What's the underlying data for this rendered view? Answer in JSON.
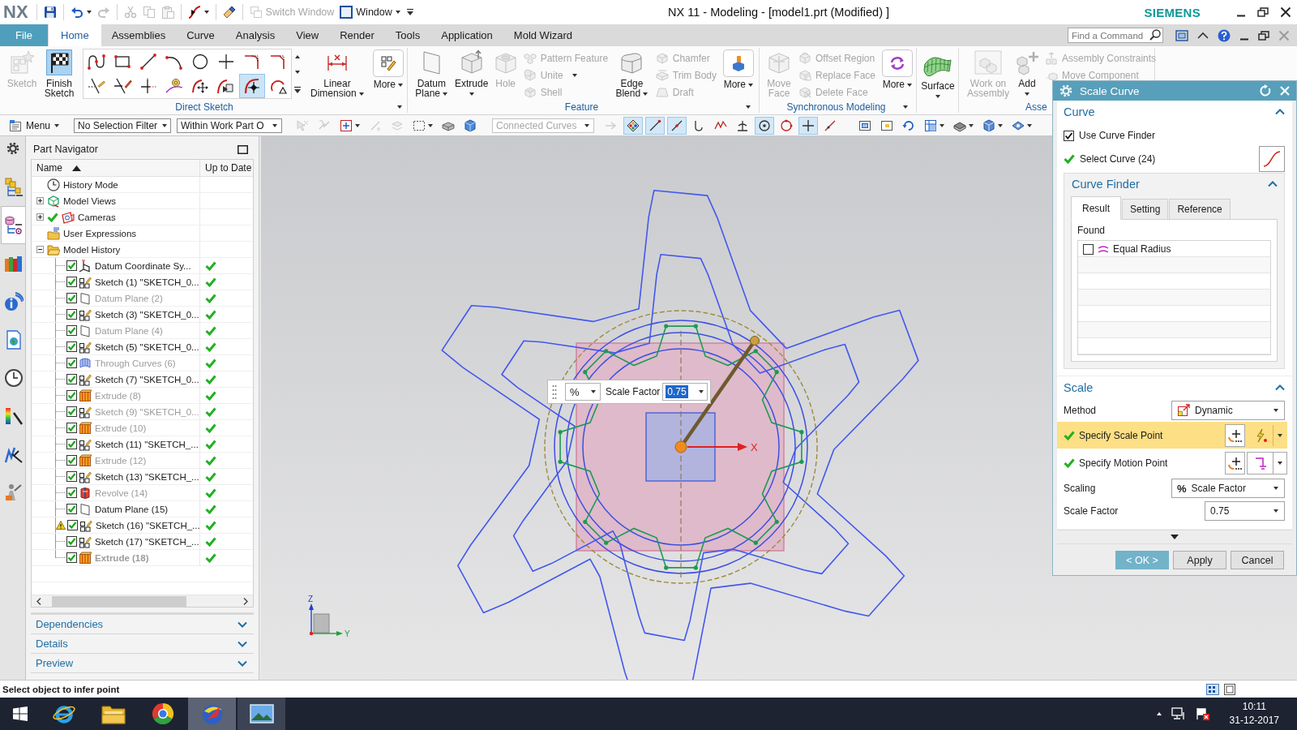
{
  "title_bar": {
    "logo": "NX",
    "quick_access": [
      [
        {
          "kind": "save",
          "disabled": false
        }
      ],
      [
        {
          "kind": "undo",
          "disabled": false,
          "dropdown": true
        },
        {
          "kind": "redo",
          "disabled": true
        }
      ],
      [
        {
          "kind": "cut",
          "disabled": true
        },
        {
          "kind": "copy",
          "disabled": true
        },
        {
          "kind": "paste",
          "disabled": true
        }
      ],
      [
        {
          "kind": "curve_tool",
          "disabled": false,
          "dropdown": true
        }
      ],
      [
        {
          "kind": "eraser",
          "disabled": false
        }
      ],
      [
        {
          "kind": "switch_window",
          "label": "Switch Window",
          "disabled": true
        },
        {
          "kind": "window",
          "label": "Window",
          "disabled": false,
          "dropdown": true
        }
      ]
    ],
    "title": "NX 11 - Modeling - [model1.prt (Modified) ]",
    "brand": "SIEMENS"
  },
  "menu_tabs": [
    {
      "label": "File",
      "kind": "file",
      "selected": false
    },
    {
      "label": "Home",
      "kind": "tab",
      "selected": true
    },
    {
      "label": "Assemblies",
      "kind": "tab",
      "selected": false
    },
    {
      "label": "Curve",
      "kind": "tab",
      "selected": false
    },
    {
      "label": "Analysis",
      "kind": "tab",
      "selected": false
    },
    {
      "label": "View",
      "kind": "tab",
      "selected": false
    },
    {
      "label": "Render",
      "kind": "tab",
      "selected": false
    },
    {
      "label": "Tools",
      "kind": "tab",
      "selected": false
    },
    {
      "label": "Application",
      "kind": "tab",
      "selected": false
    },
    {
      "label": "Mold Wizard",
      "kind": "tab",
      "selected": false
    }
  ],
  "command_search": {
    "placeholder": "Find a Command"
  },
  "ribbon": {
    "groups": [
      {
        "label": "Direct Sketch",
        "options_menu": true,
        "items": [
          {
            "kind": "sketch",
            "label": "Sketch",
            "disabled": true
          },
          {
            "kind": "finish_sketch",
            "label": "Finish Sketch",
            "disabled": false
          },
          {
            "kind": "gallery",
            "tools": [
              {
                "kind": "profile",
                "selected": false
              },
              {
                "kind": "rectangle",
                "selected": false
              },
              {
                "kind": "line",
                "selected": false
              },
              {
                "kind": "arc",
                "selected": false
              },
              {
                "kind": "circle",
                "selected": false
              },
              {
                "kind": "point",
                "selected": false
              },
              {
                "kind": "fillet",
                "selected": false
              },
              {
                "kind": "chamfer",
                "selected": false
              },
              {
                "kind": "quick_trim",
                "selected": false
              },
              {
                "kind": "quick_extend",
                "selected": false
              },
              {
                "kind": "make_corner",
                "selected": false
              },
              {
                "kind": "constraints",
                "selected": false
              },
              {
                "kind": "move_curve",
                "selected": false
              },
              {
                "kind": "offset_move_curve",
                "selected": false
              },
              {
                "kind": "scale_curve",
                "selected": true
              },
              {
                "kind": "resize_curve",
                "selected": false
              }
            ]
          },
          {
            "kind": "linear_dimension",
            "label": "Linear Dimension",
            "disabled": false,
            "dropdown": true
          },
          {
            "kind": "more_sketch",
            "label": "More",
            "disabled": false,
            "dropdown": true
          }
        ]
      },
      {
        "label": "Feature",
        "options_menu": true,
        "items": [
          {
            "kind": "datum_plane",
            "label": "Datum Plane",
            "disabled": false,
            "dropdown": true
          },
          {
            "kind": "extrude",
            "label": "Extrude",
            "disabled": false,
            "dropdown": true
          },
          {
            "kind": "hole",
            "label": "Hole",
            "disabled": true
          },
          {
            "kind": "stack",
            "tools": [
              {
                "kind": "pattern_feature",
                "label": "Pattern Feature",
                "disabled": true
              },
              {
                "kind": "unite",
                "label": "Unite",
                "disabled": true,
                "dropdown": true
              },
              {
                "kind": "shell",
                "label": "Shell",
                "disabled": true
              }
            ]
          },
          {
            "kind": "edge_blend",
            "label": "Edge Blend",
            "disabled": false,
            "dropdown": true
          },
          {
            "kind": "stack",
            "tools": [
              {
                "kind": "chamfer",
                "label": "Chamfer",
                "disabled": true
              },
              {
                "kind": "trim_body",
                "label": "Trim Body",
                "disabled": true
              },
              {
                "kind": "draft",
                "label": "Draft",
                "disabled": true
              }
            ]
          },
          {
            "kind": "more_feature",
            "label": "More",
            "disabled": false,
            "dropdown": true
          }
        ]
      },
      {
        "label": "Synchronous Modeling",
        "options_menu": true,
        "items": [
          {
            "kind": "move_face",
            "label": "Move Face",
            "disabled": true
          },
          {
            "kind": "stack",
            "tools": [
              {
                "kind": "offset_region",
                "label": "Offset Region",
                "disabled": true
              },
              {
                "kind": "replace_face",
                "label": "Replace Face",
                "disabled": true
              },
              {
                "kind": "delete_face",
                "label": "Delete Face",
                "disabled": true
              }
            ]
          },
          {
            "kind": "more_sync",
            "label": "More",
            "disabled": false,
            "dropdown": true
          }
        ]
      },
      {
        "items": [
          {
            "kind": "surface",
            "label": "Surface",
            "disabled": false,
            "dropdown": true
          }
        ]
      },
      {
        "label": "Asse",
        "items": [
          {
            "kind": "work_on_assembly",
            "label": "Work on Assembly",
            "disabled": true
          },
          {
            "kind": "add",
            "label": "Add",
            "disabled": false,
            "dropdown": true
          },
          {
            "kind": "stack",
            "tools": [
              {
                "kind": "assembly_constraints",
                "label": "Assembly Constraints",
                "disabled": true
              },
              {
                "kind": "move_component",
                "label": "Move Component",
                "disabled": true
              }
            ]
          }
        ]
      }
    ]
  },
  "toolbar": {
    "menu": {
      "label": "Menu",
      "dropdown": true
    },
    "selection_filter": "No Selection Filter",
    "scope": "Within Work Part O",
    "selection_tools": [
      {
        "kind": "deselect",
        "disabled": true
      },
      {
        "kind": "select_previous",
        "disabled": true
      },
      {
        "kind": "general_selection",
        "disabled": false,
        "dropdown": true
      },
      {
        "kind": "feature_point",
        "disabled": true
      },
      {
        "kind": "face_rule",
        "disabled": true
      },
      {
        "kind": "selection_box",
        "disabled": false,
        "dropdown": true
      },
      {
        "kind": "solid",
        "disabled": false
      },
      {
        "kind": "box_select",
        "disabled": false
      }
    ],
    "curve_rule": {
      "value": "Connected Curves",
      "disabled": true
    },
    "rule_tools": [
      {
        "kind": "stop_at_intersection",
        "disabled": true
      }
    ],
    "snap_points": [
      {
        "kind": "enable_snap",
        "on": true
      },
      {
        "kind": "end_point",
        "on": true
      },
      {
        "kind": "mid_point",
        "on": true
      },
      {
        "kind": "control_point",
        "on": false
      },
      {
        "kind": "intersection",
        "on": false
      },
      {
        "kind": "tangent",
        "on": false
      },
      {
        "kind": "arc_center",
        "on": true
      },
      {
        "kind": "quadrant",
        "on": false
      },
      {
        "kind": "existing_point",
        "on": true
      },
      {
        "kind": "point_on_curve",
        "on": false
      }
    ],
    "view_tools": [
      {
        "kind": "fit"
      },
      {
        "kind": "zoom"
      },
      {
        "kind": "rotate"
      },
      {
        "kind": "orient",
        "dropdown": true
      },
      {
        "kind": "render_style",
        "dropdown": true
      },
      {
        "kind": "work_view",
        "dropdown": true
      },
      {
        "kind": "show_hide",
        "dropdown": true
      }
    ]
  },
  "resource_bar": {
    "tabs": [
      {
        "kind": "assembly_navigator",
        "selected": false
      },
      {
        "kind": "part_navigator",
        "selected": true
      },
      {
        "kind": "reuse_library",
        "selected": false
      },
      {
        "kind": "hd3d_tools",
        "selected": false
      },
      {
        "kind": "web_browser",
        "selected": false
      },
      {
        "kind": "history",
        "selected": false
      },
      {
        "kind": "visualization",
        "selected": false
      },
      {
        "kind": "process_studio",
        "selected": false
      },
      {
        "kind": "roles",
        "selected": false
      }
    ]
  },
  "part_navigator": {
    "title": "Part Navigator",
    "columns": [
      {
        "label": "Name",
        "sort_ascending": true
      },
      {
        "label": "Up to Date"
      }
    ],
    "tree": [
      {
        "label": "History Mode",
        "kind": "history_mode"
      },
      {
        "label": "Model Views",
        "kind": "model_views",
        "expanded": false
      },
      {
        "label": "Cameras",
        "kind": "cameras",
        "expanded": false,
        "active": true
      },
      {
        "label": "User Expressions",
        "kind": "user_expressions"
      },
      {
        "label": "Model History",
        "kind": "folder",
        "expanded": true,
        "children": [
          {
            "label": "Datum Coordinate Sy...",
            "kind": "datum_csys",
            "visible": true,
            "dimmed": false,
            "current": false,
            "warning": false,
            "up_to_date": true
          },
          {
            "label": "Sketch (1) \"SKETCH_0...",
            "kind": "sketch",
            "visible": true,
            "dimmed": false,
            "current": false,
            "warning": false,
            "up_to_date": true
          },
          {
            "label": "Datum Plane (2)",
            "kind": "datum_plane",
            "visible": true,
            "dimmed": true,
            "current": false,
            "warning": false,
            "up_to_date": true
          },
          {
            "label": "Sketch (3) \"SKETCH_0...",
            "kind": "sketch",
            "visible": true,
            "dimmed": false,
            "current": false,
            "warning": false,
            "up_to_date": true
          },
          {
            "label": "Datum Plane (4)",
            "kind": "datum_plane",
            "visible": true,
            "dimmed": true,
            "current": false,
            "warning": false,
            "up_to_date": true
          },
          {
            "label": "Sketch (5) \"SKETCH_0...",
            "kind": "sketch",
            "visible": true,
            "dimmed": false,
            "current": false,
            "warning": false,
            "up_to_date": true
          },
          {
            "label": "Through Curves (6)",
            "kind": "through_curves",
            "visible": true,
            "dimmed": true,
            "current": false,
            "warning": false,
            "up_to_date": true
          },
          {
            "label": "Sketch (7) \"SKETCH_0...",
            "kind": "sketch",
            "visible": true,
            "dimmed": false,
            "current": false,
            "warning": false,
            "up_to_date": true
          },
          {
            "label": "Extrude (8)",
            "kind": "extrude",
            "visible": true,
            "dimmed": true,
            "current": false,
            "warning": false,
            "up_to_date": true
          },
          {
            "label": "Sketch (9) \"SKETCH_0...",
            "kind": "sketch",
            "visible": true,
            "dimmed": true,
            "current": false,
            "warning": false,
            "up_to_date": true
          },
          {
            "label": "Extrude (10)",
            "kind": "extrude",
            "visible": true,
            "dimmed": true,
            "current": false,
            "warning": false,
            "up_to_date": true
          },
          {
            "label": "Sketch (11) \"SKETCH_...",
            "kind": "sketch",
            "visible": true,
            "dimmed": false,
            "current": false,
            "warning": false,
            "up_to_date": true
          },
          {
            "label": "Extrude (12)",
            "kind": "extrude",
            "visible": true,
            "dimmed": true,
            "current": false,
            "warning": false,
            "up_to_date": true
          },
          {
            "label": "Sketch (13) \"SKETCH_...",
            "kind": "sketch",
            "visible": true,
            "dimmed": false,
            "current": false,
            "warning": false,
            "up_to_date": true
          },
          {
            "label": "Revolve (14)",
            "kind": "revolve",
            "visible": true,
            "dimmed": true,
            "current": false,
            "warning": false,
            "up_to_date": true
          },
          {
            "label": "Datum Plane (15)",
            "kind": "datum_plane",
            "visible": true,
            "dimmed": false,
            "current": false,
            "warning": false,
            "up_to_date": true
          },
          {
            "label": "Sketch (16) \"SKETCH_...",
            "kind": "sketch",
            "visible": true,
            "dimmed": false,
            "current": false,
            "warning": true,
            "up_to_date": true
          },
          {
            "label": "Sketch (17) \"SKETCH_...",
            "kind": "sketch",
            "visible": true,
            "dimmed": false,
            "current": false,
            "warning": false,
            "up_to_date": true
          },
          {
            "label": "Extrude (18)",
            "kind": "extrude",
            "visible": true,
            "dimmed": true,
            "current": true,
            "warning": false,
            "up_to_date": true
          }
        ]
      }
    ],
    "sections": [
      {
        "label": "Dependencies",
        "expanded": false
      },
      {
        "label": "Details",
        "expanded": false
      },
      {
        "label": "Preview",
        "expanded": false
      }
    ]
  },
  "graphics": {
    "popup": {
      "unit": "%",
      "label": "Scale Factor",
      "value": "0.75",
      "value_highlighted": true
    },
    "x_axis_label": "X",
    "triad": {
      "z_label": "Z",
      "y_label": "Y"
    }
  },
  "dialog": {
    "title": "Scale Curve",
    "curve_section": {
      "title": "Curve",
      "expanded": true,
      "use_curve_finder": {
        "label": "Use Curve Finder",
        "checked": true
      },
      "select_curve": {
        "label": "Select Curve (24)",
        "done": true
      },
      "curve_finder": {
        "title": "Curve Finder",
        "expanded": true,
        "tabs": [
          {
            "label": "Result",
            "selected": true
          },
          {
            "label": "Setting",
            "selected": false
          },
          {
            "label": "Reference",
            "selected": false
          }
        ],
        "found_label": "Found",
        "found": [
          {
            "label": "Equal Radius",
            "checked": false
          }
        ]
      }
    },
    "scale_section": {
      "title": "Scale",
      "expanded": true,
      "method": {
        "label": "Method",
        "value": "Dynamic"
      },
      "scale_point": {
        "label": "Specify Scale Point",
        "done": true,
        "active": true
      },
      "motion_point": {
        "label": "Specify Motion Point",
        "done": true,
        "active": false
      },
      "scaling": {
        "label": "Scaling",
        "symbol": "%",
        "value": "Scale Factor"
      },
      "scale_factor": {
        "label": "Scale Factor",
        "value": "0.75"
      }
    },
    "buttons": [
      {
        "label": "< OK >",
        "default": true
      },
      {
        "label": "Apply",
        "default": false
      },
      {
        "label": "Cancel",
        "default": false
      }
    ]
  },
  "status_bar": {
    "prompt": "Select object to infer point"
  },
  "taskbar": {
    "apps": [
      {
        "kind": "e_browser",
        "running": false,
        "focused": false
      },
      {
        "kind": "file_explorer",
        "running": false,
        "focused": false
      },
      {
        "kind": "wheel_browser",
        "running": false,
        "focused": false
      },
      {
        "kind": "cad_app",
        "running": true,
        "focused": true
      },
      {
        "kind": "photo_viewer",
        "running": true,
        "focused": false
      }
    ],
    "time": "10:11",
    "date": "31-12-2017"
  }
}
